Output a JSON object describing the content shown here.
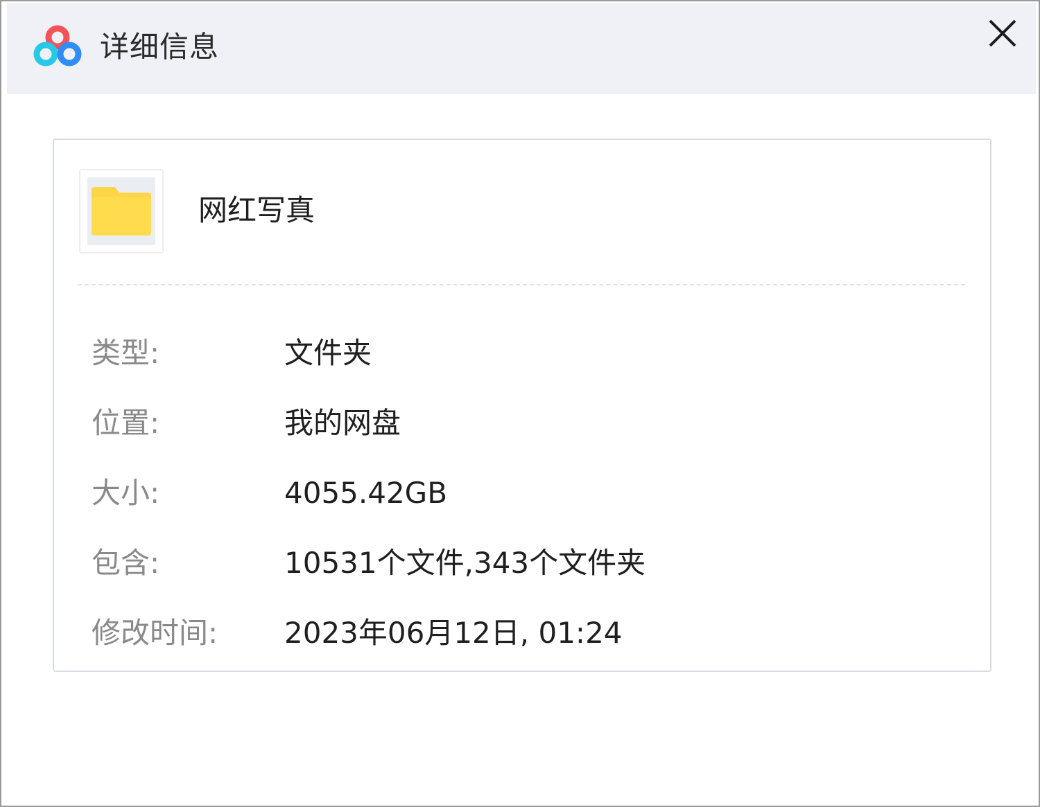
{
  "window": {
    "title": "详细信息",
    "app_icon": "baidu-netdisk-logo-icon",
    "close_icon": "close-icon"
  },
  "file": {
    "icon": "folder-icon",
    "name": "网红写真"
  },
  "details": [
    {
      "label": "类型:",
      "value": "文件夹"
    },
    {
      "label": "位置:",
      "value": "我的网盘"
    },
    {
      "label": "大小:",
      "value": "4055.42GB"
    },
    {
      "label": "包含:",
      "value": "10531个文件,343个文件夹"
    },
    {
      "label": "修改时间:",
      "value": "2023年06月12日, 01:24"
    }
  ],
  "colors": {
    "titlebar_bg": "#eff1f6",
    "folder_yellow": "#fdd647",
    "logo_blue": "#2f8df5",
    "logo_cyan": "#27c8e8",
    "logo_red": "#f2535a"
  }
}
